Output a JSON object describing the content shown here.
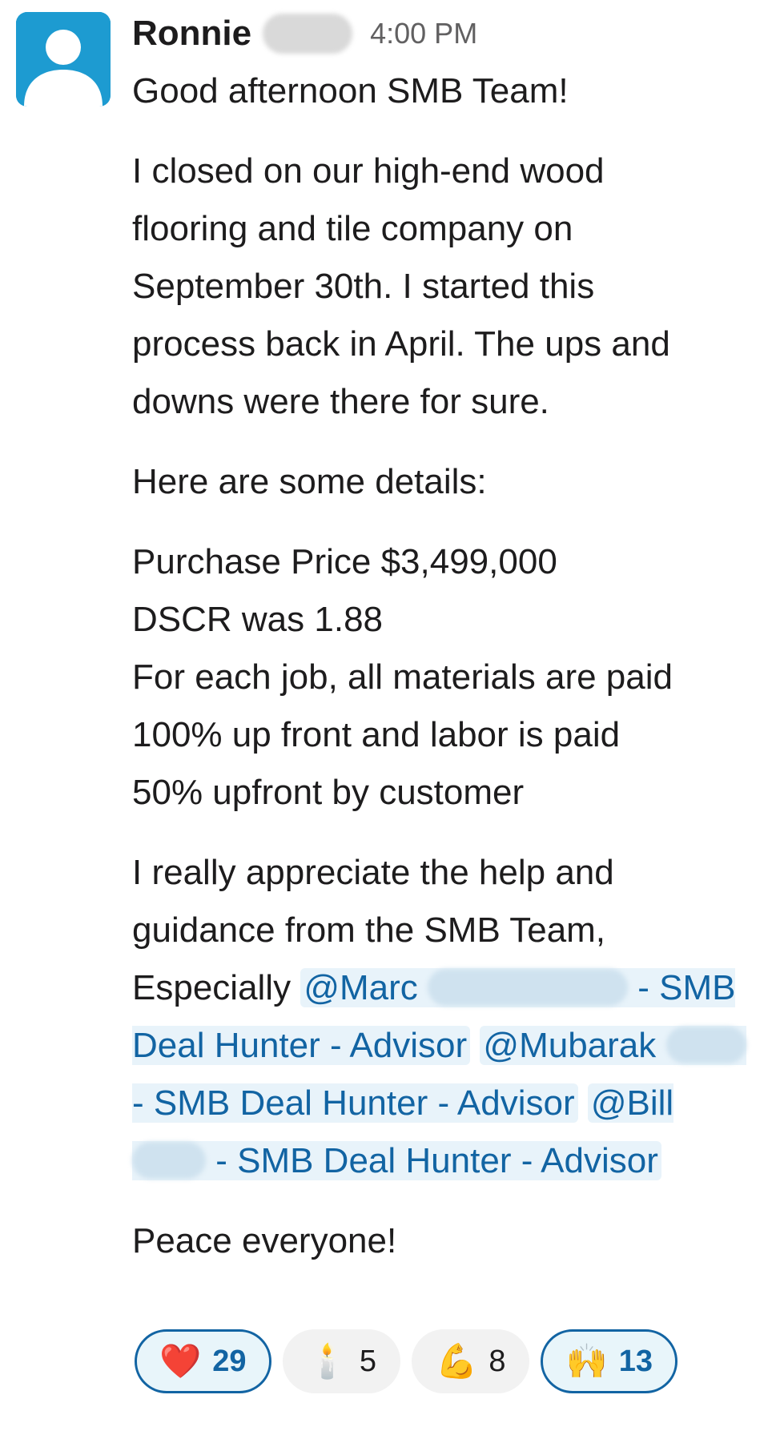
{
  "message": {
    "sender": "Ronnie",
    "timestamp": "4:00 PM",
    "greeting": "Good afternoon SMB Team!",
    "paragraph1_lines": [
      "I closed on our high-end wood",
      "flooring and tile company on",
      "September 30th. I started this",
      "process back in April. The ups and",
      "downs were there for sure."
    ],
    "details_heading": "Here are some details:",
    "details_lines": [
      "Purchase Price $3,499,000",
      "DSCR was 1.88",
      "For each job, all materials are paid",
      "100% up front and labor is paid",
      "50% upfront by customer"
    ],
    "thanks_line1": "I really appreciate the help and",
    "thanks_line2": "guidance from the SMB Team,",
    "especially": "Especially",
    "mentions": [
      {
        "handle": "@Marc",
        "role": "- SMB Deal Hunter - Advisor"
      },
      {
        "handle": "@Mubarak",
        "role": "- SMB Deal Hunter - Advisor"
      },
      {
        "handle": "@Bill",
        "role": "- SMB Deal Hunter - Advisor"
      }
    ],
    "closing": "Peace everyone!"
  },
  "reactions": [
    {
      "emoji_name": "heart-icon",
      "glyph": "❤️",
      "count": "29",
      "active": true
    },
    {
      "emoji_name": "candle-icon",
      "glyph": "🕯️",
      "count": "5",
      "active": false
    },
    {
      "emoji_name": "flexed-biceps-icon",
      "glyph": "💪",
      "count": "8",
      "active": false
    },
    {
      "emoji_name": "raising-hands-icon",
      "glyph": "🙌",
      "count": "13",
      "active": true
    }
  ]
}
